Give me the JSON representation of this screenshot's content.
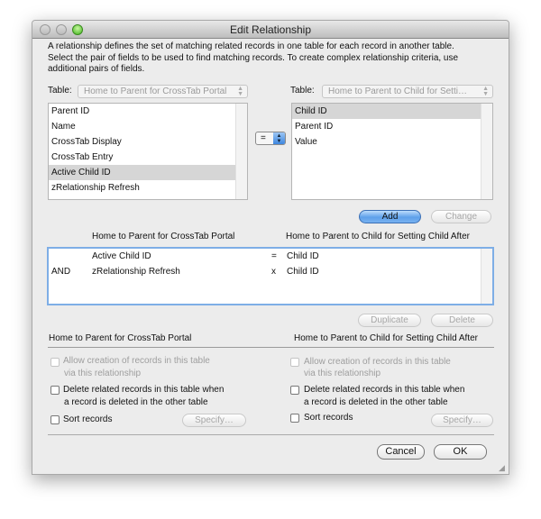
{
  "window": {
    "title": "Edit Relationship"
  },
  "description": [
    "A relationship defines the set of matching related records in one table for each record in another table.",
    "Select the pair of fields to be used to find matching records. To create complex relationship criteria, use",
    "additional pairs of fields."
  ],
  "left": {
    "table_label": "Table:",
    "table_value": "Home to Parent for CrossTab Portal",
    "fields": [
      "Parent ID",
      "Name",
      "CrossTab Display",
      "CrossTab Entry",
      "Active Child ID",
      "zRelationship Refresh"
    ],
    "selected": "Active Child ID"
  },
  "operator": {
    "value": "="
  },
  "right": {
    "table_label": "Table:",
    "table_value": "Home to Parent to Child for Setti…",
    "fields": [
      "Child ID",
      "Parent ID",
      "Value"
    ],
    "selected": "Child ID"
  },
  "buttons": {
    "add": "Add",
    "change": "Change",
    "duplicate": "Duplicate",
    "delete": "Delete",
    "specify": "Specify…",
    "cancel": "Cancel",
    "ok": "OK"
  },
  "criteria": {
    "left_header": "Home to Parent for CrossTab Portal",
    "right_header": "Home to Parent to Child for Setting Child After",
    "rows": [
      {
        "conj": "",
        "left": "Active Child ID",
        "op": "=",
        "right": "Child ID"
      },
      {
        "conj": "AND",
        "left": "zRelationship Refresh",
        "op": "x",
        "right": "Child ID"
      }
    ]
  },
  "options": {
    "left": {
      "title": "Home to Parent for CrossTab Portal",
      "allow_1": "Allow creation of records in this table",
      "allow_2": "via this relationship",
      "delete_1": "Delete related records in this table when",
      "delete_2": "a record is deleted in the other table",
      "sort": "Sort records"
    },
    "right": {
      "title": "Home to Parent to Child for Setting Child After",
      "allow_1": "Allow creation of records in this table",
      "allow_2": "via this relationship",
      "delete_1": "Delete related records in this table when",
      "delete_2": "a record is deleted in the other table",
      "sort": "Sort records"
    }
  }
}
